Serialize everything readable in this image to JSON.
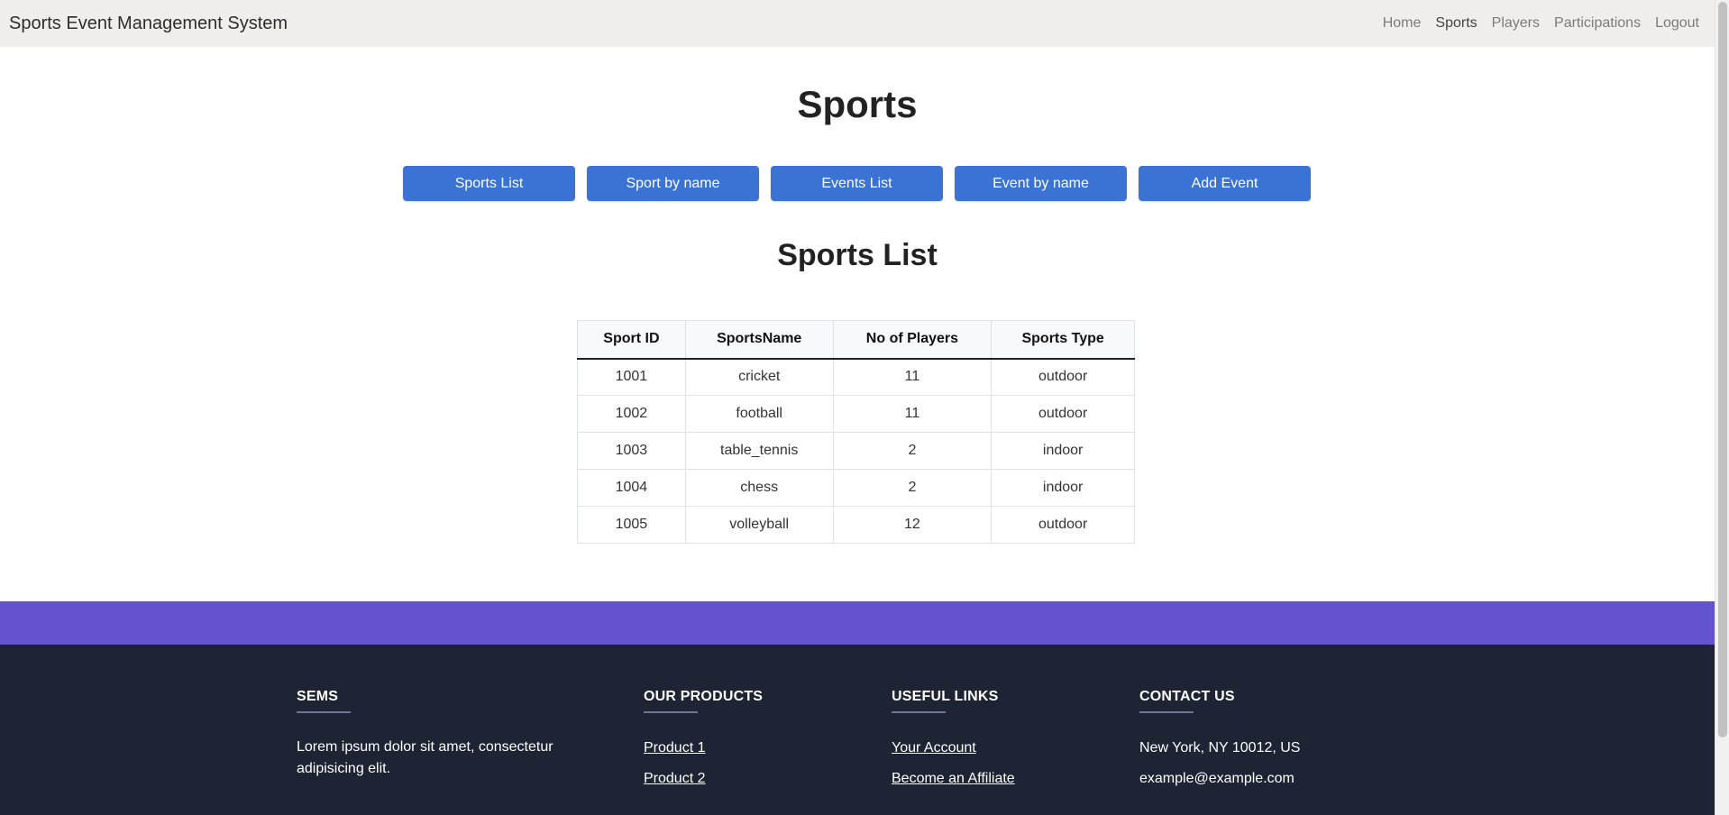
{
  "navbar": {
    "brand": "Sports Event Management System",
    "links": [
      "Home",
      "Sports",
      "Players",
      "Participations",
      "Logout"
    ]
  },
  "page": {
    "title": "Sports",
    "buttons": [
      "Sports List",
      "Sport by name",
      "Events List",
      "Event by name",
      "Add Event"
    ],
    "section_title": "Sports List"
  },
  "table": {
    "headers": [
      "Sport ID",
      "SportsName",
      "No of Players",
      "Sports Type"
    ],
    "rows": [
      [
        "1001",
        "cricket",
        "11",
        "outdoor"
      ],
      [
        "1002",
        "football",
        "11",
        "outdoor"
      ],
      [
        "1003",
        "table_tennis",
        "2",
        "indoor"
      ],
      [
        "1004",
        "chess",
        "2",
        "indoor"
      ],
      [
        "1005",
        "volleyball",
        "12",
        "outdoor"
      ]
    ]
  },
  "footer": {
    "sems": {
      "heading": "SEMS",
      "text": "Lorem ipsum dolor sit amet, consectetur adipisicing elit."
    },
    "products": {
      "heading": "OUR PRODUCTS",
      "items": [
        "Product 1",
        "Product 2"
      ]
    },
    "useful": {
      "heading": "USEFUL LINKS",
      "items": [
        "Your Account",
        "Become an Affiliate"
      ]
    },
    "contact": {
      "heading": "CONTACT US",
      "items": [
        "New York, NY 10012, US",
        "example@example.com"
      ]
    }
  },
  "colors": {
    "navbar_bg": "#efeeec",
    "button_bg": "#3a73d4",
    "footer_band": "#6353cf",
    "footer_bg": "#1e2433"
  }
}
